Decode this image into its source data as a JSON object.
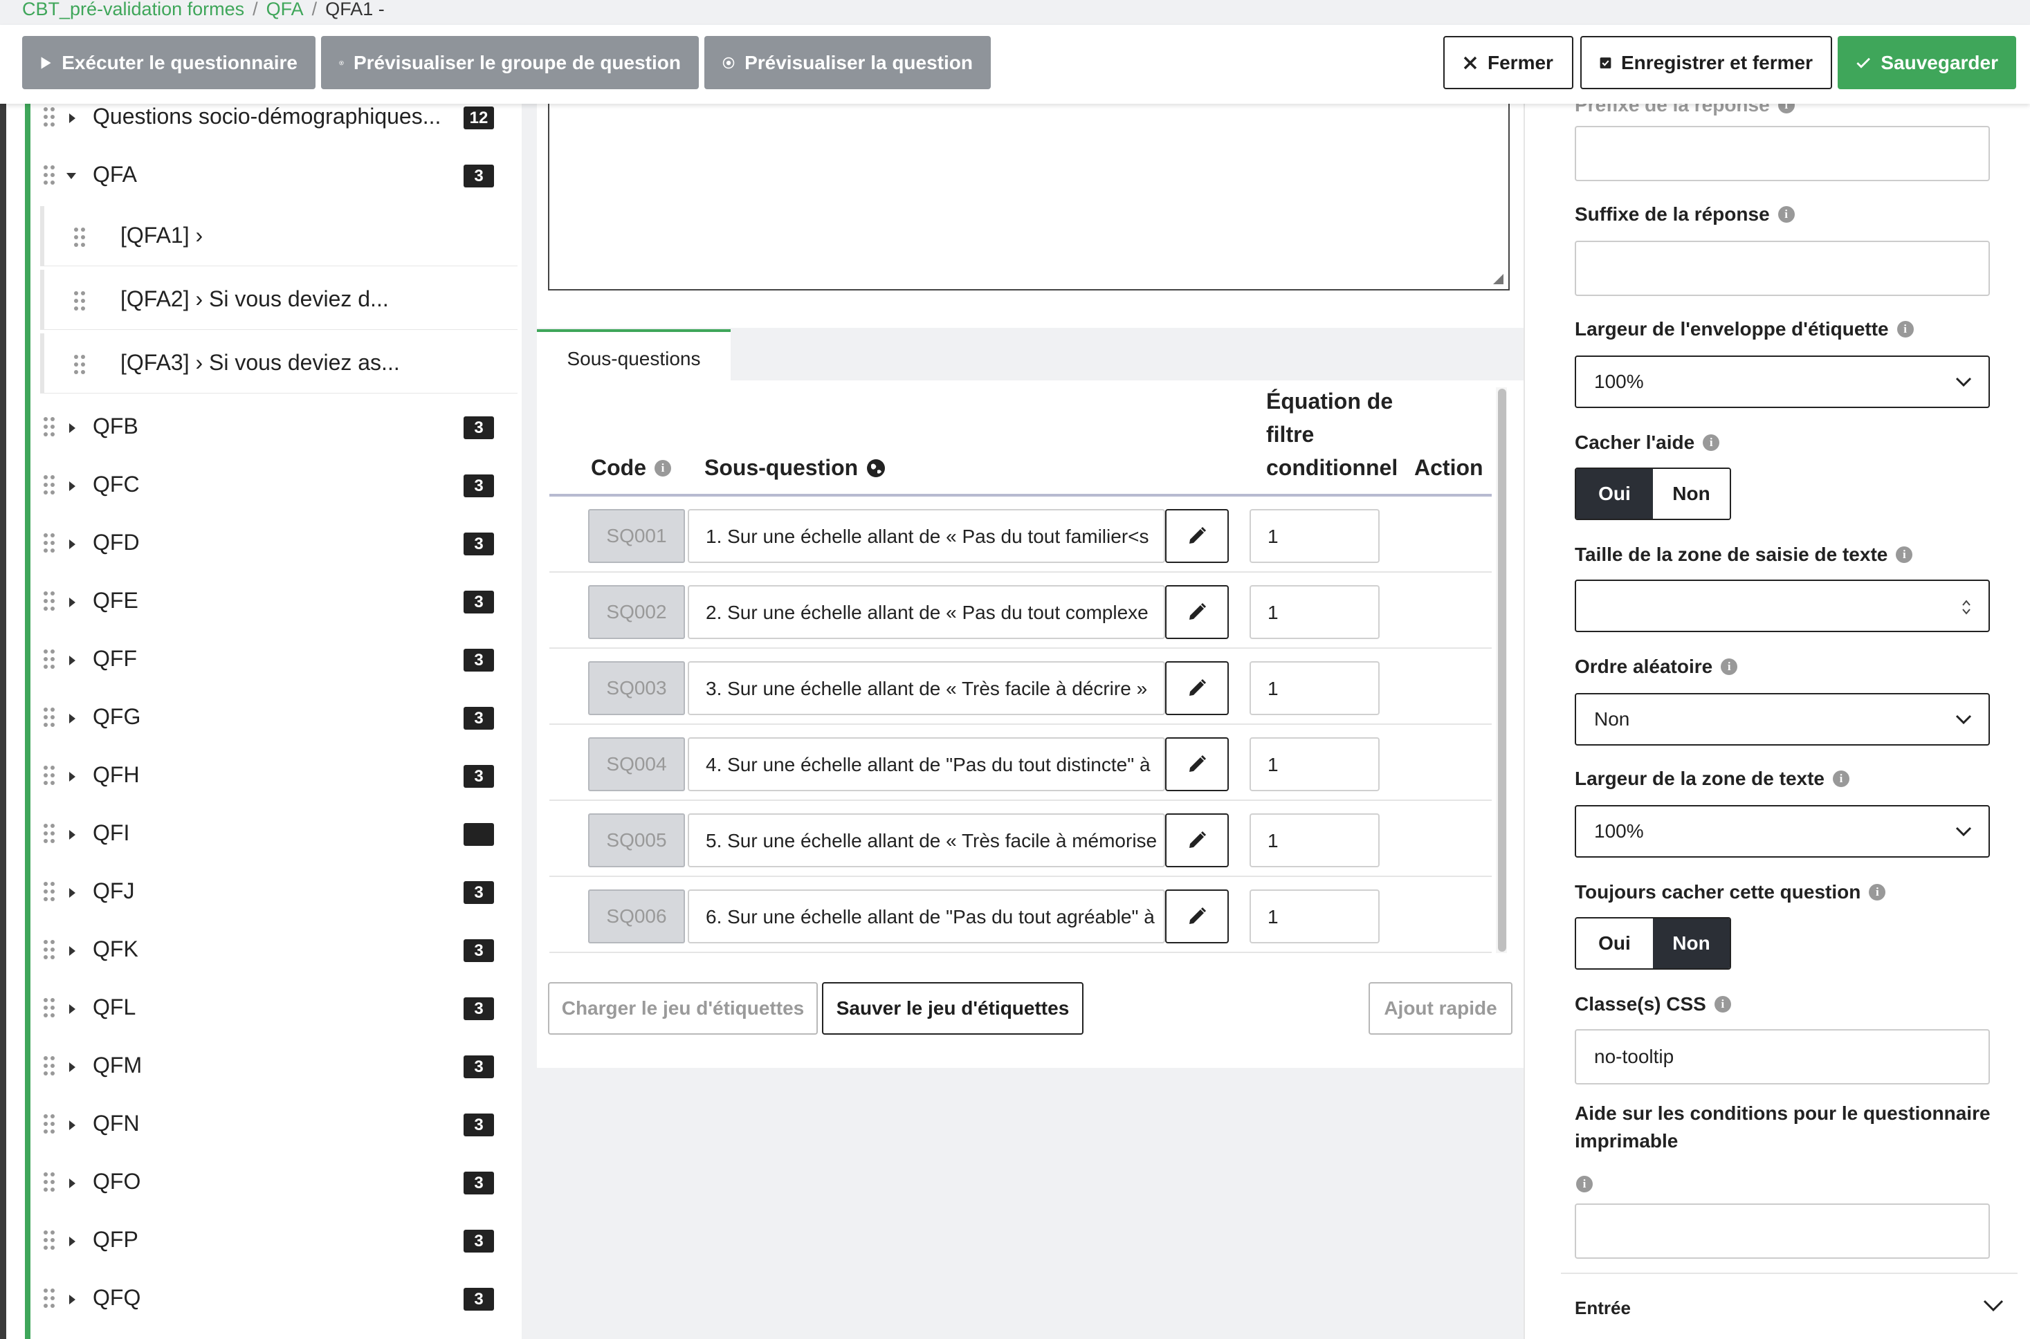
{
  "breadcrumb": {
    "survey": "CBT_pré-validation formes",
    "sep": "/",
    "group": "QFA",
    "question": "QFA1 -"
  },
  "toolbar": {
    "run": "Exécuter le questionnaire",
    "preview_group": "Prévisualiser le groupe de question",
    "preview_question": "Prévisualiser la question",
    "close": "Fermer",
    "save_close": "Enregistrer et fermer",
    "save": "Sauvegarder"
  },
  "sidebar": {
    "top_group": {
      "name": "Questions socio-démographiques...",
      "count": "12"
    },
    "open_group": {
      "name": "QFA",
      "count": "3"
    },
    "questions": [
      {
        "label": "[QFA1] ›"
      },
      {
        "label": "[QFA2] › Si vous deviez d..."
      },
      {
        "label": "[QFA3] › Si vous deviez as..."
      }
    ],
    "groups": [
      {
        "name": "QFB",
        "count": "3"
      },
      {
        "name": "QFC",
        "count": "3"
      },
      {
        "name": "QFD",
        "count": "3"
      },
      {
        "name": "QFE",
        "count": "3"
      },
      {
        "name": "QFF",
        "count": "3"
      },
      {
        "name": "QFG",
        "count": "3"
      },
      {
        "name": "QFH",
        "count": "3"
      },
      {
        "name": "QFI",
        "count": ""
      },
      {
        "name": "QFJ",
        "count": "3"
      },
      {
        "name": "QFK",
        "count": "3"
      },
      {
        "name": "QFL",
        "count": "3"
      },
      {
        "name": "QFM",
        "count": "3"
      },
      {
        "name": "QFN",
        "count": "3"
      },
      {
        "name": "QFO",
        "count": "3"
      },
      {
        "name": "QFP",
        "count": "3"
      },
      {
        "name": "QFQ",
        "count": "3"
      }
    ]
  },
  "subquestions": {
    "tab": "Sous-questions",
    "headers": {
      "code": "Code",
      "subquestion": "Sous-question",
      "equation_line1": "Équation de",
      "equation_line2": "filtre",
      "equation_line3": "conditionnel",
      "action": "Action"
    },
    "rows": [
      {
        "code": "SQ001",
        "text": "1. Sur une échelle allant de « Pas du tout familier<s",
        "equation": "1"
      },
      {
        "code": "SQ002",
        "text": "2. Sur une échelle allant de « Pas du tout complexe",
        "equation": "1"
      },
      {
        "code": "SQ003",
        "text": "3. Sur une échelle allant de « Très facile à décrire »",
        "equation": "1"
      },
      {
        "code": "SQ004",
        "text": "4. Sur une échelle allant de \"Pas du tout distincte\" à",
        "equation": "1"
      },
      {
        "code": "SQ005",
        "text": "5. Sur une échelle allant de « Très facile à mémorise",
        "equation": "1"
      },
      {
        "code": "SQ006",
        "text": "6. Sur une échelle allant de \"Pas du tout agréable\" à",
        "equation": "1"
      }
    ],
    "load_labels": "Charger le jeu d'étiquettes",
    "save_labels": "Sauver le jeu d'étiquettes",
    "quick_add": "Ajout rapide"
  },
  "settings": {
    "prefix_label": "Préfixe de la réponse",
    "suffix_label": "Suffixe de la réponse",
    "label_wrapper_width_label": "Largeur de l'enveloppe d'étiquette",
    "label_wrapper_width_value": "100%",
    "hide_help_label": "Cacher l'aide",
    "yes": "Oui",
    "no": "Non",
    "text_input_size_label": "Taille de la zone de saisie de texte",
    "random_order_label": "Ordre aléatoire",
    "random_order_value": "Non",
    "text_width_label": "Largeur de la zone de texte",
    "text_width_value": "100%",
    "always_hide_label": "Toujours cacher cette question",
    "css_class_label": "Classe(s) CSS",
    "css_class_value": "no-tooltip",
    "print_help_label_line1": "Aide sur les conditions pour le questionnaire",
    "print_help_label_line2": "imprimable",
    "accordion_label": "Entrée"
  },
  "colors": {
    "accent": "#3fa65a",
    "dark": "#2b2f36",
    "grey_button": "#8f949a"
  }
}
